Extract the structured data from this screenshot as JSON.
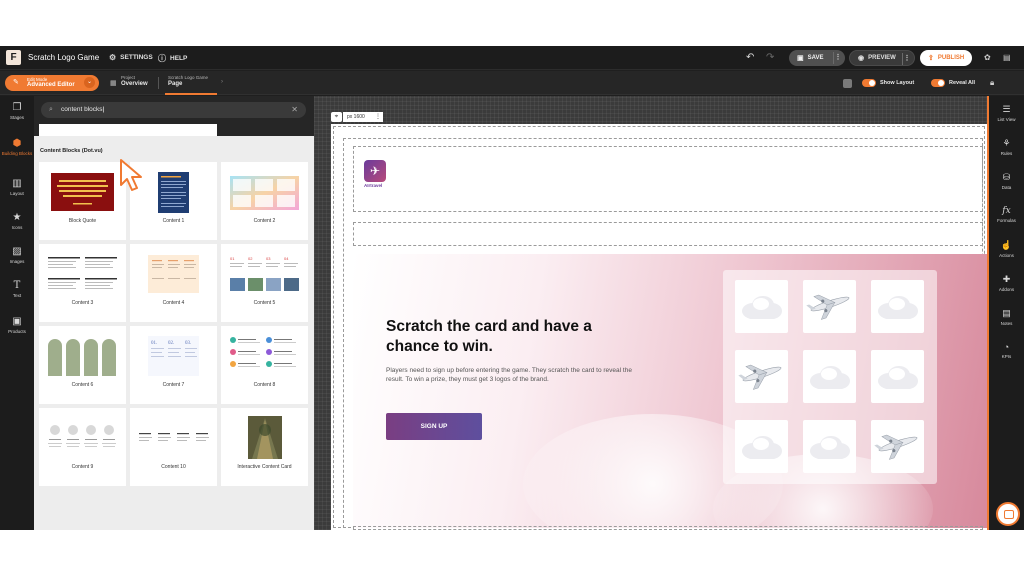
{
  "app": {
    "logo_letter": "F",
    "title": "Scratch Logo Game"
  },
  "topbar": {
    "settings": "SETTINGS",
    "help": "HELP",
    "save": "SAVE",
    "preview": "PREVIEW",
    "publish": "PUBLISH"
  },
  "subbar": {
    "edit_mode_small": "Edit Mode",
    "edit_mode": "Advanced Editor",
    "crumb1_small": "Project",
    "crumb1": "Overview",
    "crumb2_small": "Scratch Logo Game",
    "crumb2": "Page",
    "show_layout": "Show Layout",
    "reveal_all": "Reveal All"
  },
  "left_rail": [
    {
      "icon": "stages-icon",
      "label": "Stages"
    },
    {
      "icon": "building-blocks-icon",
      "label": "Building Blocks"
    },
    {
      "icon": "layout-icon",
      "label": "Layout"
    },
    {
      "icon": "star-icon",
      "label": "Icons"
    },
    {
      "icon": "image-icon",
      "label": "Images"
    },
    {
      "icon": "text-icon",
      "label": "Text"
    },
    {
      "icon": "products-icon",
      "label": "Products"
    }
  ],
  "panel": {
    "search_value": "content blocks",
    "section_title": "Content Blocks (Dot.vu)",
    "cards": [
      {
        "label": "Block Quote"
      },
      {
        "label": "Content 1"
      },
      {
        "label": "Content 2"
      },
      {
        "label": "Content 3"
      },
      {
        "label": "Content 4"
      },
      {
        "label": "Content 5"
      },
      {
        "label": "Content 6"
      },
      {
        "label": "Content 7"
      },
      {
        "label": "Content 8"
      },
      {
        "label": "Content 9"
      },
      {
        "label": "Content 10"
      },
      {
        "label": "Interactive Content Card"
      }
    ]
  },
  "canvas": {
    "px_label": "px 1600",
    "brand_name": "AIrtravel",
    "headline": "Scratch the card and have a chance to win.",
    "description": "Players need to sign up before entering the game. They scratch the card to reveal the result. To win a prize, they must get 3 logos of the brand.",
    "cta": "SIGN UP",
    "tiles": [
      "cloud",
      "plane",
      "cloud",
      "plane",
      "cloud",
      "cloud",
      "cloud",
      "cloud",
      "plane"
    ]
  },
  "right_rail": [
    {
      "icon": "list-view-icon",
      "label": "List View"
    },
    {
      "icon": "rules-icon",
      "label": "Rules"
    },
    {
      "icon": "data-icon",
      "label": "Data"
    },
    {
      "icon": "formulas-icon",
      "label": "Formulas"
    },
    {
      "icon": "actions-icon",
      "label": "Actions"
    },
    {
      "icon": "addons-icon",
      "label": "Addons"
    },
    {
      "icon": "notes-icon",
      "label": "Notes"
    },
    {
      "icon": "kpis-icon",
      "label": "KPIs"
    }
  ],
  "colors": {
    "accent": "#f07a32",
    "cta": "#6a4690",
    "hero_pink": "#d7899c"
  }
}
